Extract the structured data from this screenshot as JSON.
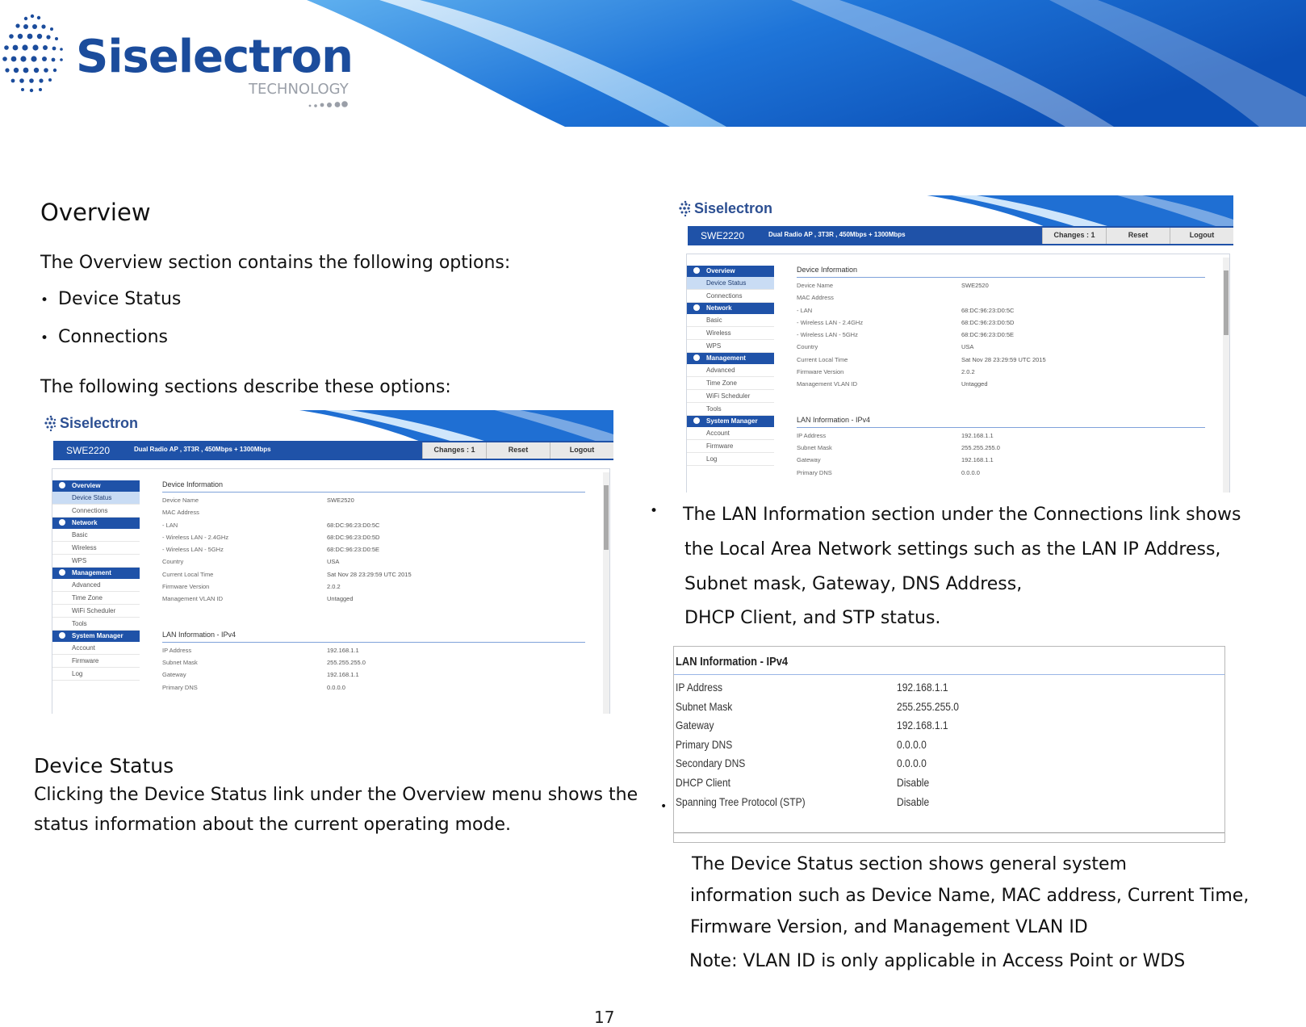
{
  "header": {
    "brand_name": "Siselectron",
    "brand_tagline": "TECHNOLOGY"
  },
  "overview": {
    "title": "Overview",
    "intro": "The  Overview section   contains the   following  options:",
    "options": [
      "Device  Status",
      "Connections"
    ],
    "describe": "The  following  sections describe these    options:"
  },
  "device_status": {
    "title": "Device   Status",
    "line1": "Clicking the   Device   Status link under   the   Overview menu shows   the",
    "line2": "status    information about   the   current   operating mode."
  },
  "lan_paragraph": {
    "line1": "The   LAN Information  section  under    the    Connections link shows",
    "line2": "the    Local  Area  Network    settings  such    as   the  LAN   IP  Address,",
    "line3": "Subnet   mask,  Gateway,   DNS Address,",
    "line4": "DHCP Client, and  STP status."
  },
  "device_paragraph": {
    "line1": "The       Device       Status      section    shows        general      system",
    "line2": "information    such    as   Device   Name,   MAC  address,  Current  Time,",
    "line3": "Firmware  Version, and  Management VLAN ID",
    "line4": "Note:    VLAN ID is only applicable  in Access  Point  or WDS"
  },
  "router_ui": {
    "brand": "Siselectron",
    "model": "SWE2220",
    "description": "Dual Radio AP , 3T3R , 450Mbps + 1300Mbps",
    "buttons": [
      "Changes : 1",
      "Reset",
      "Logout"
    ],
    "menu": {
      "overview": "Overview",
      "overview_items": [
        "Device Status",
        "Connections"
      ],
      "network": "Network",
      "network_items": [
        "Basic",
        "Wireless",
        "WPS"
      ],
      "management": "Management",
      "management_items": [
        "Advanced",
        "Time Zone",
        "WiFi Scheduler",
        "Tools"
      ],
      "system": "System Manager",
      "system_items": [
        "Account",
        "Firmware",
        "Log"
      ]
    },
    "device_info_title": "Device Information",
    "device_info": [
      {
        "k": "Device Name",
        "v": "SWE2520"
      },
      {
        "k": "MAC Address",
        "v": ""
      },
      {
        "k": "  - LAN",
        "v": "68:DC:96:23:D0:5C"
      },
      {
        "k": "  - Wireless LAN - 2.4GHz",
        "v": "68:DC:96:23:D0:5D"
      },
      {
        "k": "  - Wireless LAN - 5GHz",
        "v": "68:DC:96:23:D0:5E"
      },
      {
        "k": "Country",
        "v": "USA"
      },
      {
        "k": "Current Local Time",
        "v": "Sat Nov 28 23:29:59 UTC 2015"
      },
      {
        "k": "Firmware Version",
        "v": "2.0.2"
      },
      {
        "k": "Management VLAN ID",
        "v": "Untagged"
      }
    ],
    "lan_info_title": "LAN Information - IPv4",
    "lan_info": [
      {
        "k": "IP Address",
        "v": "192.168.1.1"
      },
      {
        "k": "Subnet Mask",
        "v": "255.255.255.0"
      },
      {
        "k": "Gateway",
        "v": "192.168.1.1"
      },
      {
        "k": "Primary DNS",
        "v": "0.0.0.0"
      }
    ]
  },
  "lan_table": {
    "title": "LAN Information - IPv4",
    "rows": [
      {
        "k": "IP Address",
        "v": "192.168.1.1"
      },
      {
        "k": "Subnet Mask",
        "v": "255.255.255.0"
      },
      {
        "k": "Gateway",
        "v": "192.168.1.1"
      },
      {
        "k": "Primary DNS",
        "v": "0.0.0.0"
      },
      {
        "k": "Secondary DNS",
        "v": "0.0.0.0"
      },
      {
        "k": "DHCP Client",
        "v": "Disable"
      },
      {
        "k": "Spanning Tree Protocol (STP)",
        "v": "Disable"
      }
    ]
  },
  "page_number": "17",
  "colors": {
    "brand_blue": "#1b4c9c",
    "bar_blue": "#1f52a8"
  }
}
